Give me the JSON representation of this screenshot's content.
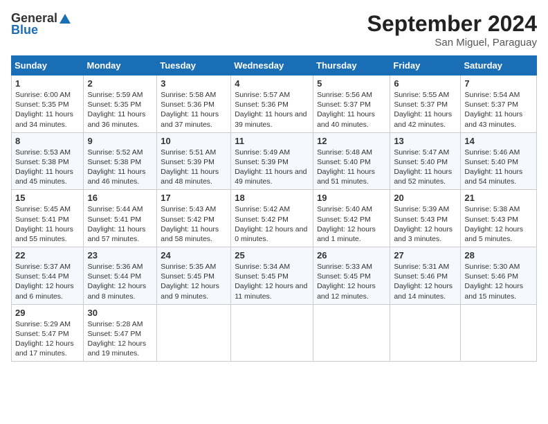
{
  "header": {
    "logo_general": "General",
    "logo_blue": "Blue",
    "month_year": "September 2024",
    "location": "San Miguel, Paraguay"
  },
  "weekdays": [
    "Sunday",
    "Monday",
    "Tuesday",
    "Wednesday",
    "Thursday",
    "Friday",
    "Saturday"
  ],
  "weeks": [
    [
      {
        "day": 1,
        "sunrise": "6:00 AM",
        "sunset": "5:35 PM",
        "daylight": "11 hours and 34 minutes."
      },
      {
        "day": 2,
        "sunrise": "5:59 AM",
        "sunset": "5:35 PM",
        "daylight": "11 hours and 36 minutes."
      },
      {
        "day": 3,
        "sunrise": "5:58 AM",
        "sunset": "5:36 PM",
        "daylight": "11 hours and 37 minutes."
      },
      {
        "day": 4,
        "sunrise": "5:57 AM",
        "sunset": "5:36 PM",
        "daylight": "11 hours and 39 minutes."
      },
      {
        "day": 5,
        "sunrise": "5:56 AM",
        "sunset": "5:37 PM",
        "daylight": "11 hours and 40 minutes."
      },
      {
        "day": 6,
        "sunrise": "5:55 AM",
        "sunset": "5:37 PM",
        "daylight": "11 hours and 42 minutes."
      },
      {
        "day": 7,
        "sunrise": "5:54 AM",
        "sunset": "5:37 PM",
        "daylight": "11 hours and 43 minutes."
      }
    ],
    [
      {
        "day": 8,
        "sunrise": "5:53 AM",
        "sunset": "5:38 PM",
        "daylight": "11 hours and 45 minutes."
      },
      {
        "day": 9,
        "sunrise": "5:52 AM",
        "sunset": "5:38 PM",
        "daylight": "11 hours and 46 minutes."
      },
      {
        "day": 10,
        "sunrise": "5:51 AM",
        "sunset": "5:39 PM",
        "daylight": "11 hours and 48 minutes."
      },
      {
        "day": 11,
        "sunrise": "5:49 AM",
        "sunset": "5:39 PM",
        "daylight": "11 hours and 49 minutes."
      },
      {
        "day": 12,
        "sunrise": "5:48 AM",
        "sunset": "5:40 PM",
        "daylight": "11 hours and 51 minutes."
      },
      {
        "day": 13,
        "sunrise": "5:47 AM",
        "sunset": "5:40 PM",
        "daylight": "11 hours and 52 minutes."
      },
      {
        "day": 14,
        "sunrise": "5:46 AM",
        "sunset": "5:40 PM",
        "daylight": "11 hours and 54 minutes."
      }
    ],
    [
      {
        "day": 15,
        "sunrise": "5:45 AM",
        "sunset": "5:41 PM",
        "daylight": "11 hours and 55 minutes."
      },
      {
        "day": 16,
        "sunrise": "5:44 AM",
        "sunset": "5:41 PM",
        "daylight": "11 hours and 57 minutes."
      },
      {
        "day": 17,
        "sunrise": "5:43 AM",
        "sunset": "5:42 PM",
        "daylight": "11 hours and 58 minutes."
      },
      {
        "day": 18,
        "sunrise": "5:42 AM",
        "sunset": "5:42 PM",
        "daylight": "12 hours and 0 minutes."
      },
      {
        "day": 19,
        "sunrise": "5:40 AM",
        "sunset": "5:42 PM",
        "daylight": "12 hours and 1 minute."
      },
      {
        "day": 20,
        "sunrise": "5:39 AM",
        "sunset": "5:43 PM",
        "daylight": "12 hours and 3 minutes."
      },
      {
        "day": 21,
        "sunrise": "5:38 AM",
        "sunset": "5:43 PM",
        "daylight": "12 hours and 5 minutes."
      }
    ],
    [
      {
        "day": 22,
        "sunrise": "5:37 AM",
        "sunset": "5:44 PM",
        "daylight": "12 hours and 6 minutes."
      },
      {
        "day": 23,
        "sunrise": "5:36 AM",
        "sunset": "5:44 PM",
        "daylight": "12 hours and 8 minutes."
      },
      {
        "day": 24,
        "sunrise": "5:35 AM",
        "sunset": "5:45 PM",
        "daylight": "12 hours and 9 minutes."
      },
      {
        "day": 25,
        "sunrise": "5:34 AM",
        "sunset": "5:45 PM",
        "daylight": "12 hours and 11 minutes."
      },
      {
        "day": 26,
        "sunrise": "5:33 AM",
        "sunset": "5:45 PM",
        "daylight": "12 hours and 12 minutes."
      },
      {
        "day": 27,
        "sunrise": "5:31 AM",
        "sunset": "5:46 PM",
        "daylight": "12 hours and 14 minutes."
      },
      {
        "day": 28,
        "sunrise": "5:30 AM",
        "sunset": "5:46 PM",
        "daylight": "12 hours and 15 minutes."
      }
    ],
    [
      {
        "day": 29,
        "sunrise": "5:29 AM",
        "sunset": "5:47 PM",
        "daylight": "12 hours and 17 minutes."
      },
      {
        "day": 30,
        "sunrise": "5:28 AM",
        "sunset": "5:47 PM",
        "daylight": "12 hours and 19 minutes."
      },
      null,
      null,
      null,
      null,
      null
    ]
  ],
  "labels": {
    "sunrise": "Sunrise:",
    "sunset": "Sunset:",
    "daylight": "Daylight:"
  }
}
